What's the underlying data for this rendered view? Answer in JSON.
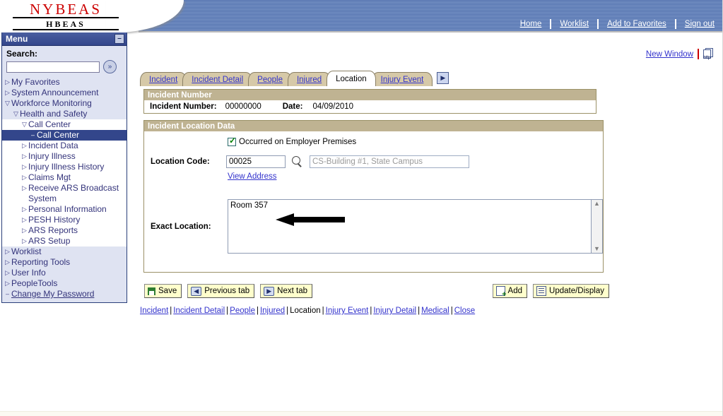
{
  "brand": {
    "logo_main": "NYBEAS",
    "logo_sub": "HBEAS"
  },
  "header": {
    "links": [
      {
        "label": "Home"
      },
      {
        "label": "Worklist"
      },
      {
        "label": "Add to Favorites"
      },
      {
        "label": "Sign out"
      }
    ]
  },
  "new_window": {
    "label": "New Window",
    "icon": "http-document-icon"
  },
  "menu": {
    "title": "Menu",
    "minimize_icon": "minimize-icon",
    "search_label": "Search:",
    "search_value": "",
    "search_button_icon": "double-chevron-right-icon",
    "items": [
      {
        "label": "My Favorites",
        "level": 1,
        "marker": "collapsed",
        "selected": false,
        "link": false
      },
      {
        "label": "System Announcement",
        "level": 1,
        "marker": "collapsed",
        "selected": false,
        "link": false
      },
      {
        "label": "Workforce Monitoring",
        "level": 1,
        "marker": "expanded",
        "selected": false,
        "link": false
      },
      {
        "label": "Health and Safety",
        "level": 2,
        "marker": "expanded",
        "selected": false,
        "link": false
      },
      {
        "label": "Call Center",
        "level": 3,
        "marker": "expanded",
        "selected": false,
        "link": false
      },
      {
        "label": "Call Center",
        "level": 4,
        "marker": "leaf",
        "selected": true,
        "link": false
      },
      {
        "label": "Incident Data",
        "level": 3,
        "marker": "collapsed",
        "selected": false,
        "link": false
      },
      {
        "label": "Injury Illness",
        "level": 3,
        "marker": "collapsed",
        "selected": false,
        "link": false
      },
      {
        "label": "Injury Illness History",
        "level": 3,
        "marker": "collapsed",
        "selected": false,
        "link": false
      },
      {
        "label": "Claims Mgt",
        "level": 3,
        "marker": "collapsed",
        "selected": false,
        "link": false
      },
      {
        "label": "Receive ARS Broadcast System",
        "level": 3,
        "marker": "collapsed",
        "selected": false,
        "link": false
      },
      {
        "label": "Personal Information",
        "level": 3,
        "marker": "collapsed",
        "selected": false,
        "link": false
      },
      {
        "label": "PESH History",
        "level": 3,
        "marker": "collapsed",
        "selected": false,
        "link": false
      },
      {
        "label": "ARS Reports",
        "level": 3,
        "marker": "collapsed",
        "selected": false,
        "link": false
      },
      {
        "label": "ARS Setup",
        "level": 3,
        "marker": "collapsed",
        "selected": false,
        "link": false
      },
      {
        "label": "Worklist",
        "level": 1,
        "marker": "collapsed",
        "selected": false,
        "link": false
      },
      {
        "label": "Reporting Tools",
        "level": 1,
        "marker": "collapsed",
        "selected": false,
        "link": false
      },
      {
        "label": "User Info",
        "level": 1,
        "marker": "collapsed",
        "selected": false,
        "link": false
      },
      {
        "label": "PeopleTools",
        "level": 1,
        "marker": "collapsed",
        "selected": false,
        "link": false
      },
      {
        "label": "Change My Password",
        "level": 1,
        "marker": "leaf",
        "selected": false,
        "link": true
      }
    ]
  },
  "tabs": {
    "items": [
      {
        "label": "Incident",
        "active": false
      },
      {
        "label": "Incident Detail",
        "active": false
      },
      {
        "label": "People",
        "active": false
      },
      {
        "label": "Injured",
        "active": false
      },
      {
        "label": "Location",
        "active": true
      },
      {
        "label": "Injury Event",
        "active": false
      }
    ],
    "next_icon": "chevron-right-icon"
  },
  "incident_panel": {
    "header": "Incident Number",
    "number_label": "Incident Number:",
    "number_value": "00000000",
    "date_label": "Date:",
    "date_value": "04/09/2010"
  },
  "location_panel": {
    "header": "Incident Location Data",
    "checkbox": {
      "label": "Occurred on Employer Premises",
      "checked": true
    },
    "location_code": {
      "label": "Location Code:",
      "value": "00025",
      "lookup_icon": "magnifier-icon",
      "description_value": "CS-Building #1, State Campus"
    },
    "view_address_link": "View Address",
    "exact_location": {
      "label": "Exact Location:",
      "value": "Room 357",
      "scroll_up_icon": "scroll-up-icon",
      "scroll_down_icon": "scroll-down-icon"
    },
    "annotation": "arrow-pointing-to-exact-location"
  },
  "buttons": {
    "save": {
      "label": "Save",
      "icon": "save-disk-icon"
    },
    "previous_tab": {
      "label": "Previous tab",
      "icon": "arrow-left-icon"
    },
    "next_tab": {
      "label": "Next tab",
      "icon": "arrow-right-icon"
    },
    "add": {
      "label": "Add",
      "icon": "add-document-icon"
    },
    "update_display": {
      "label": "Update/Display",
      "icon": "update-display-icon"
    }
  },
  "footer": {
    "links": [
      {
        "label": "Incident",
        "current": false
      },
      {
        "label": "Incident Detail",
        "current": false
      },
      {
        "label": "People",
        "current": false
      },
      {
        "label": "Injured",
        "current": false
      },
      {
        "label": "Location",
        "current": true
      },
      {
        "label": "Injury Event",
        "current": false
      },
      {
        "label": "Injury Detail",
        "current": false
      },
      {
        "label": "Medical",
        "current": false
      },
      {
        "label": "Close",
        "current": false
      }
    ],
    "separator": "|"
  },
  "colors": {
    "banner_blue": "#4f6fac",
    "menu_header": "#33468b",
    "panel_header": "#bfb392",
    "tab_inactive": "#d6c9a8",
    "link": "#3333cc",
    "button_face": "#ffffcc",
    "selected_item": "#33468b"
  }
}
